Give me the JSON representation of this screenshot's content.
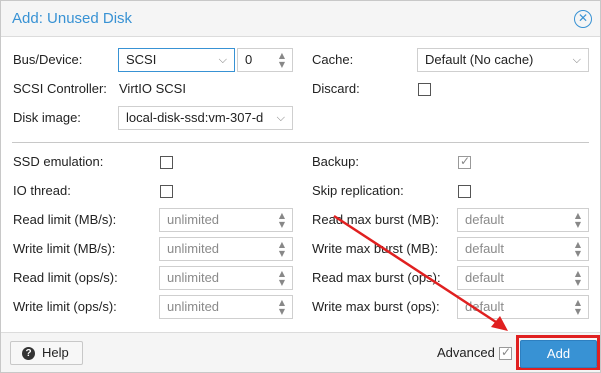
{
  "dialog": {
    "title": "Add: Unused Disk",
    "close_icon": "close-icon"
  },
  "general": {
    "bus_device_label": "Bus/Device:",
    "bus_value": "SCSI",
    "device_number": "0",
    "scsi_controller_label": "SCSI Controller:",
    "scsi_controller_value": "VirtIO SCSI",
    "disk_image_label": "Disk image:",
    "disk_image_value": "local-disk-ssd:vm-307-d",
    "cache_label": "Cache:",
    "cache_value": "Default (No cache)",
    "discard_label": "Discard:",
    "discard_checked": false
  },
  "advanced": {
    "ssd_emulation_label": "SSD emulation:",
    "ssd_emulation_checked": false,
    "io_thread_label": "IO thread:",
    "io_thread_checked": false,
    "backup_label": "Backup:",
    "backup_checked": true,
    "skip_replication_label": "Skip replication:",
    "skip_replication_checked": false,
    "read_limit_mbs_label": "Read limit (MB/s):",
    "read_limit_mbs_value": "unlimited",
    "write_limit_mbs_label": "Write limit (MB/s):",
    "write_limit_mbs_value": "unlimited",
    "read_limit_ops_label": "Read limit (ops/s):",
    "read_limit_ops_value": "unlimited",
    "write_limit_ops_label": "Write limit (ops/s):",
    "write_limit_ops_value": "unlimited",
    "read_burst_mb_label": "Read max burst (MB):",
    "read_burst_mb_value": "default",
    "write_burst_mb_label": "Write max burst (MB):",
    "write_burst_mb_value": "default",
    "read_burst_ops_label": "Read max burst (ops):",
    "read_burst_ops_value": "default",
    "write_burst_ops_label": "Write max burst (ops):",
    "write_burst_ops_value": "default"
  },
  "footer": {
    "help_label": "Help",
    "advanced_label": "Advanced",
    "advanced_checked": true,
    "add_label": "Add"
  },
  "colors": {
    "accent": "#3892d4",
    "annotation": "#e02020"
  }
}
